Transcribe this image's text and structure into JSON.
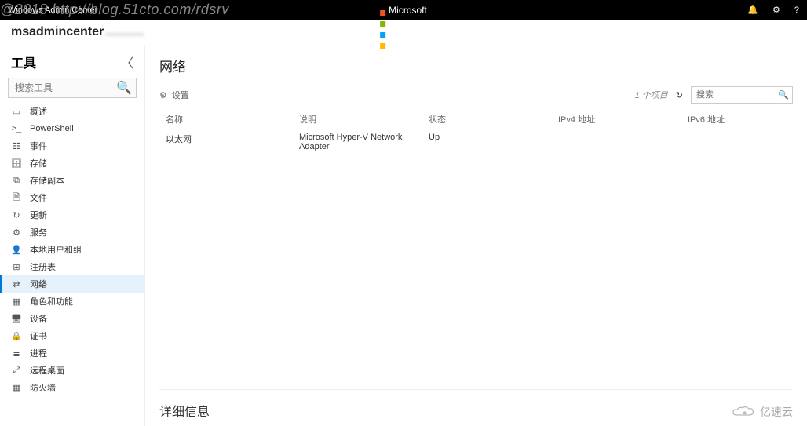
{
  "watermark_top": "@2018 http://blog.51cto.com/rdsrv",
  "watermark_bottom": "亿速云",
  "topbar": {
    "left_text": "Windows Admin Center",
    "brand": "Microsoft"
  },
  "header": {
    "hostname": "msadmincenter",
    "blurred": "..........."
  },
  "sidebar": {
    "title": "工具",
    "search_placeholder": "搜索工具",
    "items": [
      {
        "icon": "▭",
        "label": "概述"
      },
      {
        "icon": ">_",
        "label": "PowerShell"
      },
      {
        "icon": "☷",
        "label": "事件"
      },
      {
        "icon": "🗄",
        "label": "存储"
      },
      {
        "icon": "⧉",
        "label": "存储副本"
      },
      {
        "icon": "🗎",
        "label": "文件"
      },
      {
        "icon": "↻",
        "label": "更新"
      },
      {
        "icon": "⚙",
        "label": "服务"
      },
      {
        "icon": "👤",
        "label": "本地用户和组"
      },
      {
        "icon": "⊞",
        "label": "注册表"
      },
      {
        "icon": "⇄",
        "label": "网络",
        "active": true
      },
      {
        "icon": "▦",
        "label": "角色和功能"
      },
      {
        "icon": "🖥",
        "label": "设备"
      },
      {
        "icon": "🔒",
        "label": "证书"
      },
      {
        "icon": "≣",
        "label": "进程"
      },
      {
        "icon": "⤢",
        "label": "远程桌面"
      },
      {
        "icon": "▦",
        "label": "防火墙"
      }
    ]
  },
  "main": {
    "title": "网络",
    "settings_label": "设置",
    "item_count": "1 个项目",
    "search_placeholder": "搜索",
    "columns": {
      "name": "名称",
      "desc": "说明",
      "status": "状态",
      "ipv4": "IPv4 地址",
      "ipv6": "IPv6 地址"
    },
    "rows": [
      {
        "name": "以太网",
        "desc": "Microsoft Hyper-V Network Adapter",
        "status": "Up",
        "ipv4_hidden": true
      }
    ],
    "details_title": "详细信息"
  }
}
